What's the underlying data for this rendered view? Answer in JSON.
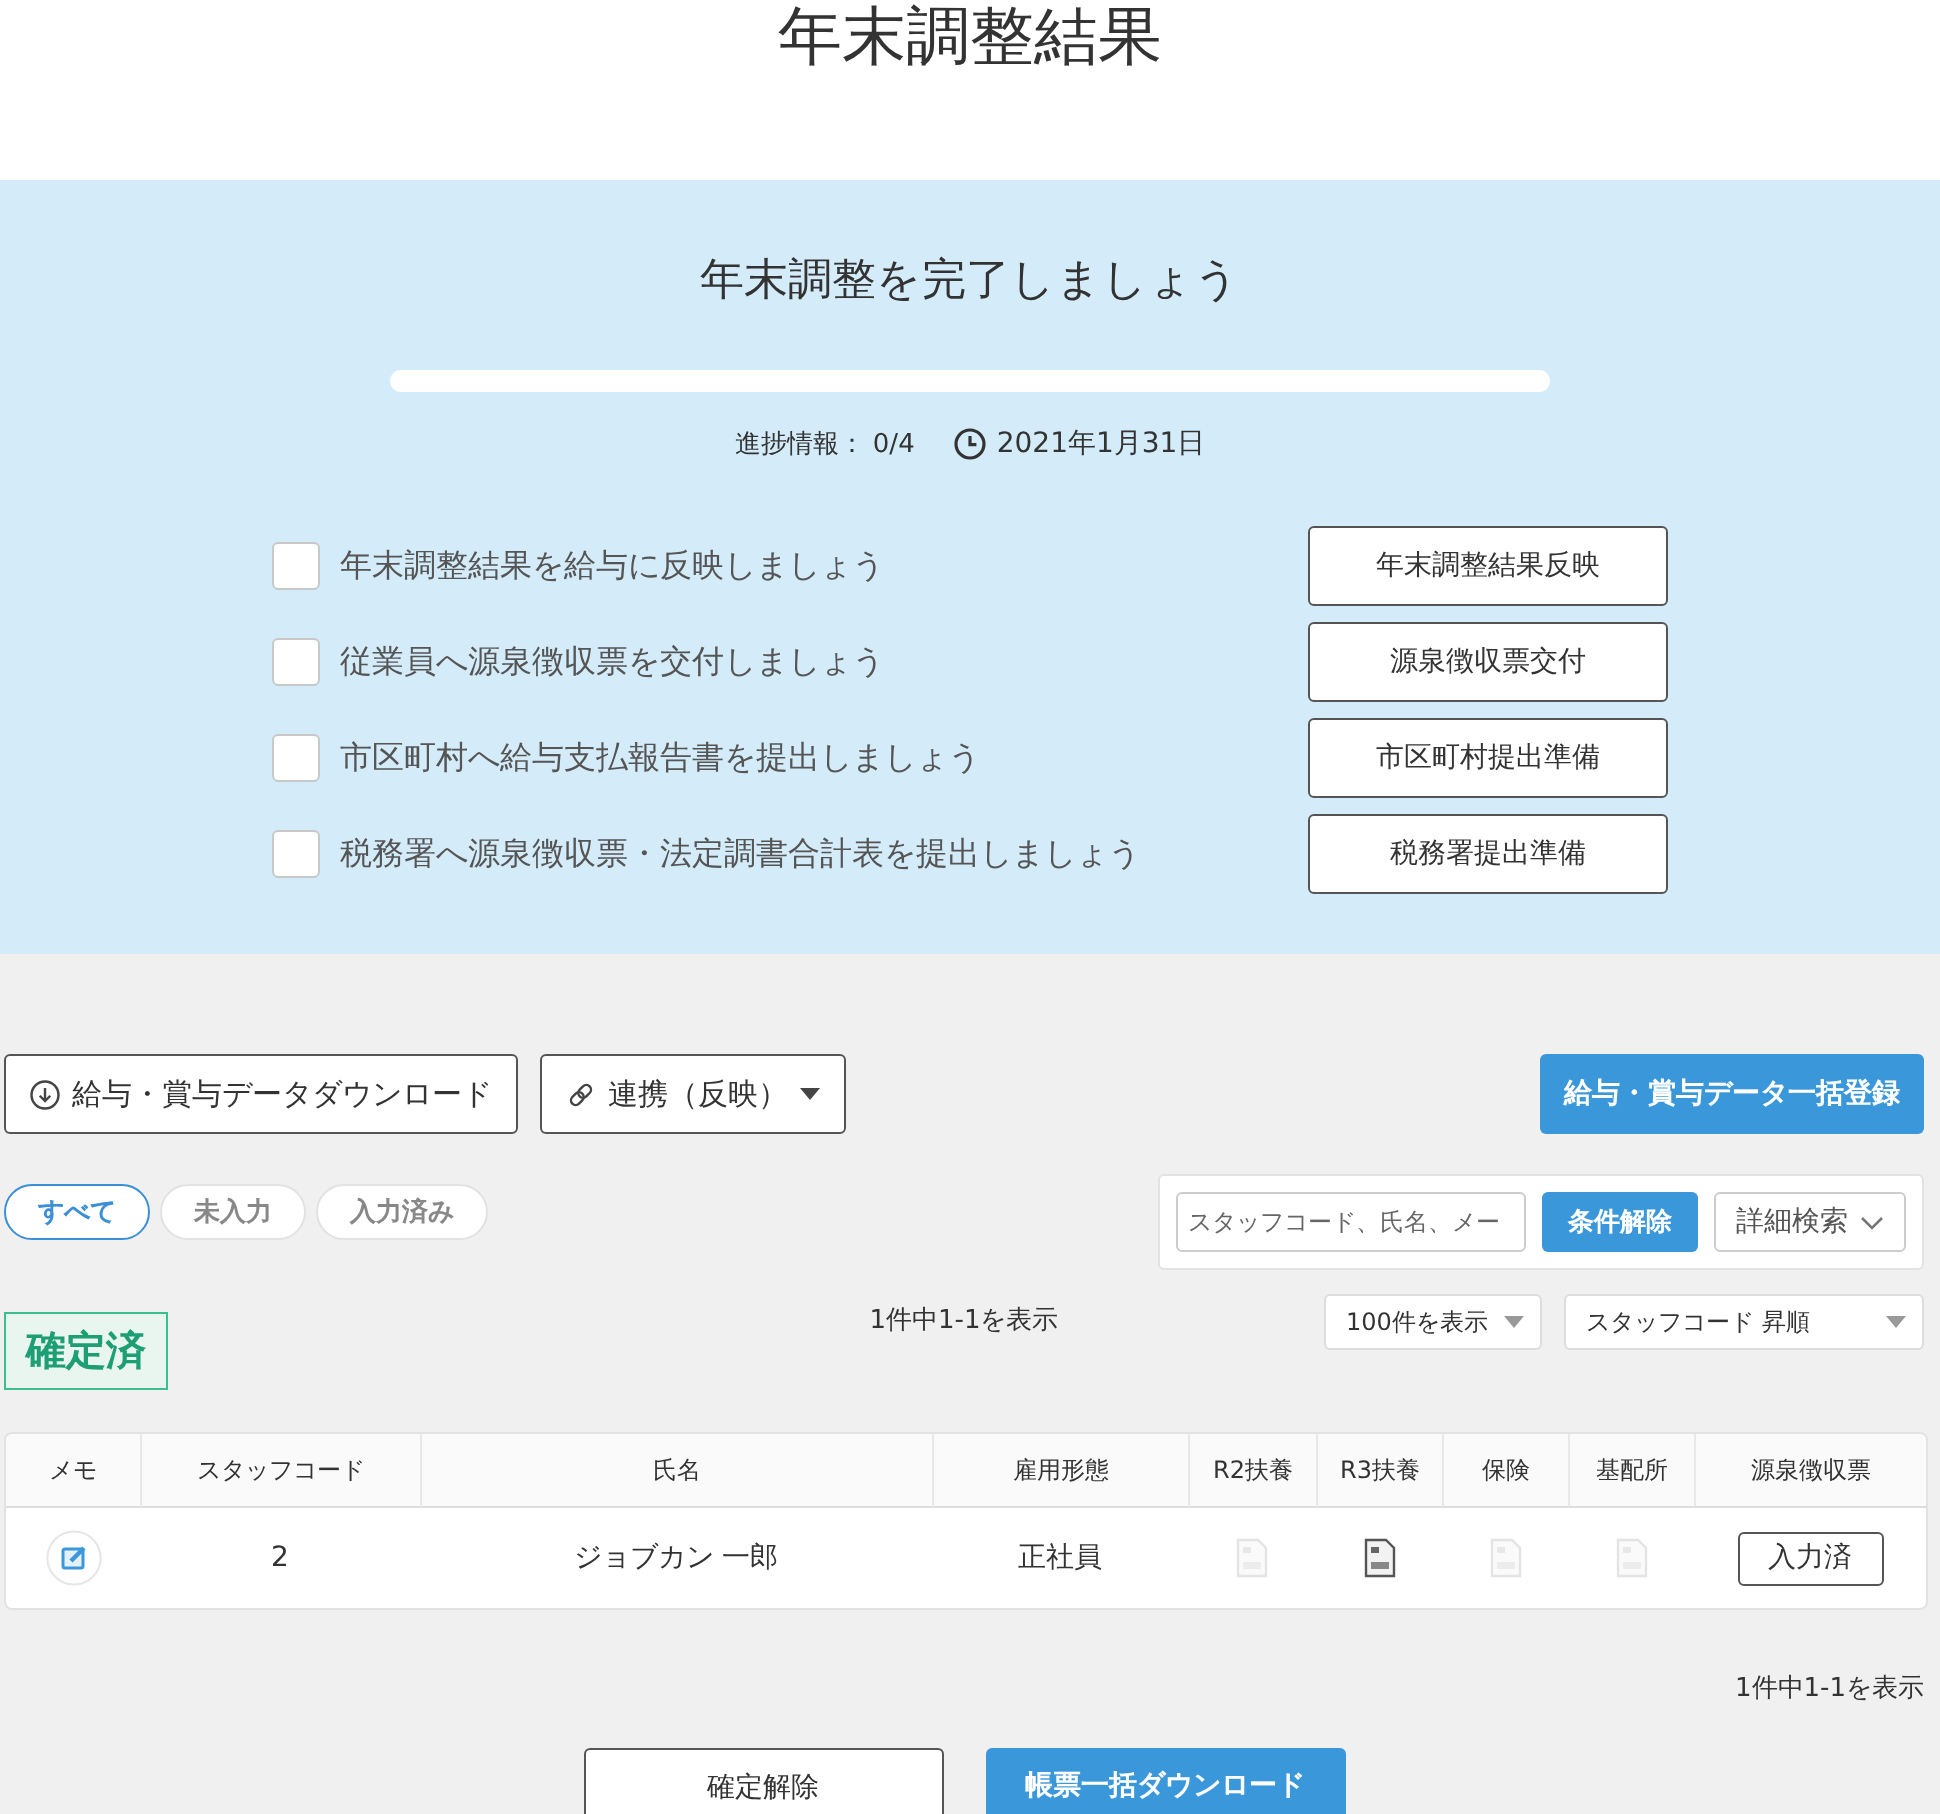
{
  "page_title": "年末調整結果",
  "progress_panel": {
    "heading": "年末調整を完了しましょう",
    "progress": "進捗情報： 0/4",
    "deadline": "2021年1月31日",
    "tasks": [
      {
        "label": "年末調整結果を給与に反映しましょう",
        "checked": false,
        "button": "年末調整結果反映"
      },
      {
        "label": "従業員へ源泉徴収票を交付しましょう",
        "checked": false,
        "button": "源泉徴収票交付"
      },
      {
        "label": "市区町村へ給与支払報告書を提出しましょう",
        "checked": false,
        "button": "市区町村提出準備"
      },
      {
        "label": "税務署へ源泉徴収票・法定調書合計表を提出しましょう",
        "checked": false,
        "button": "税務署提出準備"
      }
    ]
  },
  "toolbar": {
    "buttons": [
      {
        "kind": "download",
        "label": "給与・賞与データダウンロード"
      },
      {
        "kind": "link",
        "label": "連携（反映）"
      }
    ],
    "register_button": "給与・賞与データ一括登録"
  },
  "filters": [
    {
      "label": "すべて",
      "selected": true
    },
    {
      "label": "未入力",
      "selected": false
    },
    {
      "label": "入力済み",
      "selected": false
    }
  ],
  "search": {
    "placeholder": "スタッフコード、氏名、メー",
    "clear_button": "条件解除",
    "advanced_button": "詳細検索"
  },
  "status_badge": "確定済",
  "result_count_top": "1件中1-1を表示",
  "page_size_select": "100件を表示",
  "sort_select": "スタッフコード 昇順",
  "table": {
    "columns": [
      "メモ",
      "スタッフコード",
      "氏名",
      "雇用形態",
      "R2扶養",
      "R3扶養",
      "保険",
      "基配所",
      "源泉徴収票"
    ],
    "rows": [
      {
        "staff_code": "2",
        "name": "ジョブカン 一郎",
        "employment_type": "正社員",
        "documents": [
          {
            "available": false
          },
          {
            "available": true
          },
          {
            "available": false
          },
          {
            "available": false
          }
        ],
        "withholding_button": "入力済"
      }
    ]
  },
  "result_count_bottom": "1件中1-1を表示",
  "footer_buttons": [
    {
      "kind": "secondary",
      "label": "確定解除"
    },
    {
      "kind": "primary",
      "label": "帳票一括ダウンロード"
    }
  ]
}
